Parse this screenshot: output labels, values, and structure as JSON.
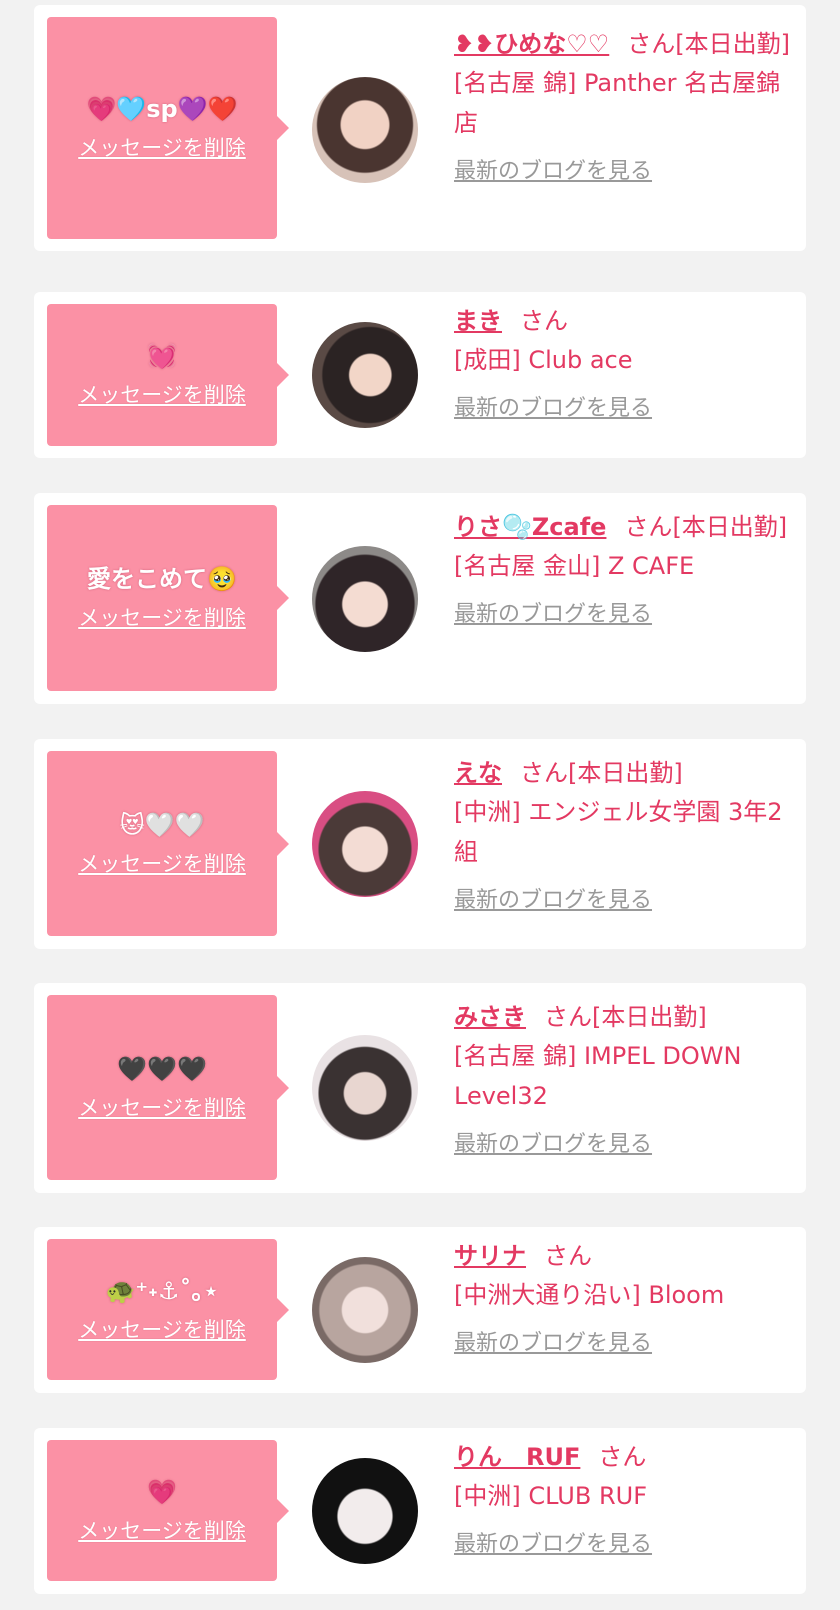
{
  "list": {
    "cards": [
      {
        "message": "💗🩵sp💜❤️",
        "delete_label": "メッセージを削除",
        "name": "❥❥ひめな♡♡",
        "honorific": "さん",
        "status": "[本日出勤]",
        "store": "[名古屋 錦] Panther 名古屋錦店",
        "blog_label": "最新のブログを見る",
        "avatar_icon": "profile-photo"
      },
      {
        "message": "💓",
        "delete_label": "メッセージを削除",
        "name": "まき",
        "honorific": "さん",
        "status": "",
        "store": "[成田] Club ace",
        "blog_label": "最新のブログを見る",
        "avatar_icon": "profile-photo"
      },
      {
        "message": "愛をこめて🥹",
        "delete_label": "メッセージを削除",
        "name": "りさ🫧Zcafe",
        "honorific": "さん",
        "status": "[本日出勤]",
        "store": "[名古屋 金山] Z CAFE",
        "blog_label": "最新のブログを見る",
        "avatar_icon": "profile-photo"
      },
      {
        "message": "😻🤍🤍",
        "delete_label": "メッセージを削除",
        "name": "えな",
        "honorific": "さん",
        "status": "[本日出勤]",
        "store": "[中洲] エンジェル女学園 3年2組",
        "blog_label": "最新のブログを見る",
        "avatar_icon": "profile-photo"
      },
      {
        "message": "🖤🖤🖤",
        "delete_label": "メッセージを削除",
        "name": "みさき",
        "honorific": "さん",
        "status": "[本日出勤]",
        "store": "[名古屋 錦] IMPEL DOWN Level32",
        "blog_label": "最新のブログを見る",
        "avatar_icon": "profile-photo"
      },
      {
        "message": "🐢⁺˖⚓︎˚｡⋆",
        "delete_label": "メッセージを削除",
        "name": "サリナ",
        "honorific": "さん",
        "status": "",
        "store": "[中洲大通り沿い] Bloom",
        "blog_label": "最新のブログを見る",
        "avatar_icon": "profile-photo"
      },
      {
        "message": "💗",
        "delete_label": "メッセージを削除",
        "name": "りん　RUF",
        "honorific": "さん",
        "status": "",
        "store": "[中洲] CLUB RUF",
        "blog_label": "最新のブログを見る",
        "avatar_icon": "profile-photo"
      }
    ]
  },
  "colors": {
    "accent": "#e33962",
    "bubble": "#fb91a5",
    "background": "#f2f2f2",
    "link_gray": "#999999"
  }
}
